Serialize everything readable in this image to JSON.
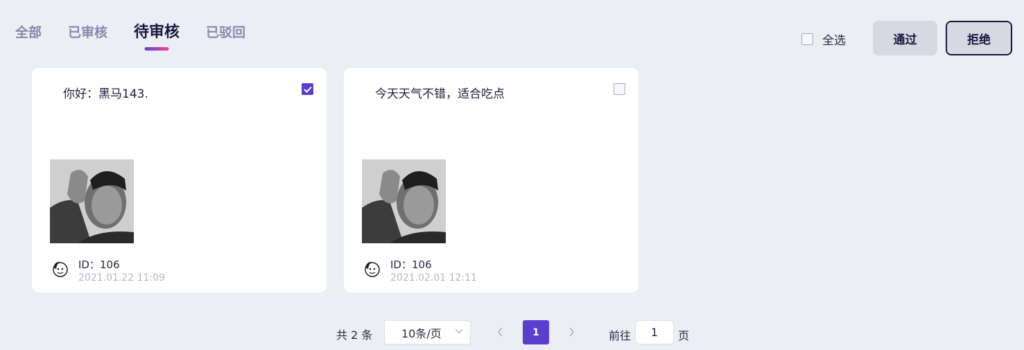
{
  "tabs": [
    {
      "label": "全部",
      "active": false
    },
    {
      "label": "已审核",
      "active": false
    },
    {
      "label": "待审核",
      "active": true
    },
    {
      "label": "已驳回",
      "active": false
    }
  ],
  "toolbar": {
    "select_all_label": "全选",
    "select_all_checked": false,
    "pass_label": "通过",
    "reject_label": "拒绝"
  },
  "cards": [
    {
      "text": "你好：黑马143.",
      "checked": true,
      "id_label": "ID：",
      "id_value": "106",
      "time": "2021.01.22 11:09"
    },
    {
      "text": "今天天气不错，适合吃点",
      "checked": false,
      "id_label": "ID：",
      "id_value": "106",
      "time": "2021.02.01 12:11"
    }
  ],
  "pagination": {
    "total_text": "共 2 条",
    "page_size": "10条/页",
    "current_page": "1",
    "goto_label": "前往",
    "goto_value": "1",
    "page_suffix": "页"
  },
  "colors": {
    "accent": "#5a3ed0",
    "underline_start": "#6a3fd3",
    "underline_end": "#ee4c80",
    "background": "#ebeef2"
  }
}
